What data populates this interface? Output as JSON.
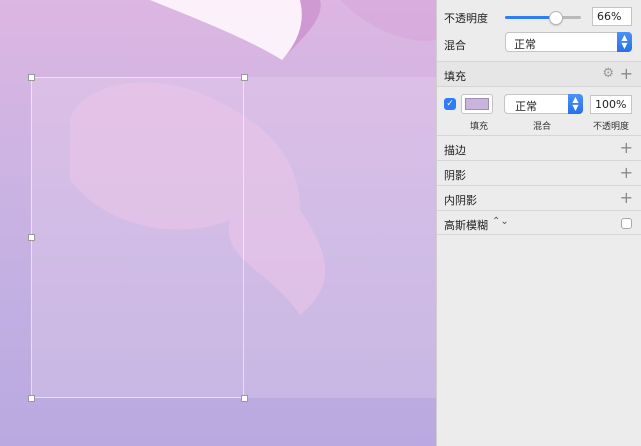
{
  "colors": {
    "fill_swatch": "#c8b4dc",
    "accent": "#2f7df6"
  },
  "opacity": {
    "label": "不透明度",
    "value_text": "66%",
    "level": 0.66
  },
  "blend": {
    "label": "混合",
    "value": "正常"
  },
  "fill": {
    "title": "填充",
    "blend_value": "正常",
    "opacity_value": "100%",
    "sub_fill": "填充",
    "sub_blend": "混合",
    "sub_opacity": "不透明度",
    "enabled": true
  },
  "sections": {
    "border": "描边",
    "shadow": "阴影",
    "inner_shadow": "内阴影",
    "gaussian_blur": "高斯模糊"
  },
  "icons": {
    "add": "plus-icon",
    "settings": "gear-icon",
    "stepper": "updown-chevron-icon",
    "check": "checkmark-icon"
  }
}
